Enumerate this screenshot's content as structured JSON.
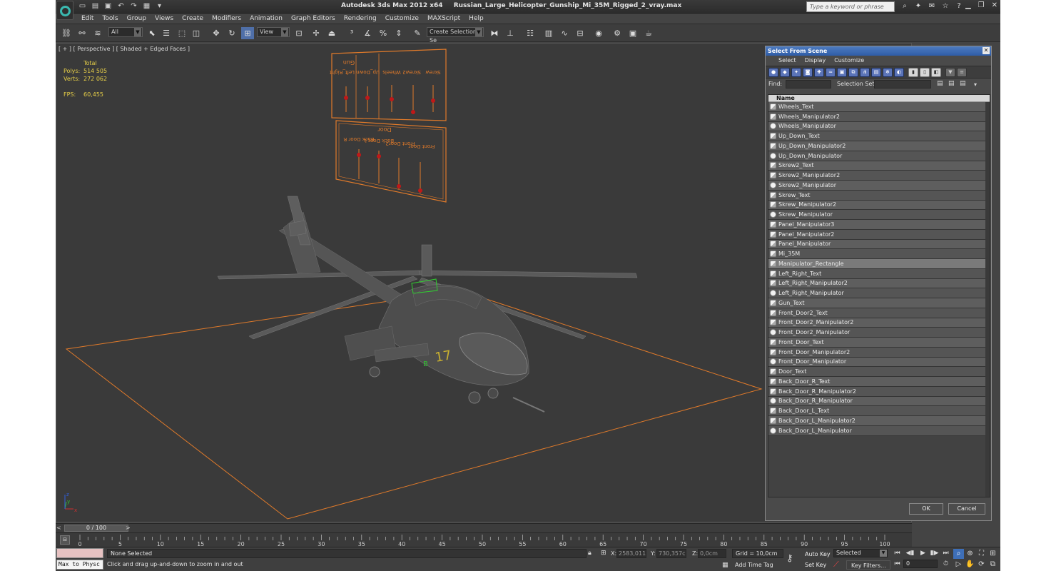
{
  "window": {
    "app_title": "Autodesk 3ds Max  2012 x64",
    "file_name": "Russian_Large_Helicopter_Gunship_Mi_35M_Rigged_2_vray.max",
    "search_placeholder": "Type a keyword or phrase"
  },
  "menu": [
    "Edit",
    "Tools",
    "Group",
    "Views",
    "Create",
    "Modifiers",
    "Animation",
    "Graph Editors",
    "Rendering",
    "Customize",
    "MAXScript",
    "Help"
  ],
  "toolbar": {
    "filter_value": "All",
    "refcoord_value": "View",
    "selection_set_placeholder": "Create Selection Se"
  },
  "viewport": {
    "label": "[ + ] [ Perspective ] [ Shaded + Edged Faces ]",
    "stats_header": "Total",
    "polys_label": "Polys:",
    "polys_value": "514 505",
    "verts_label": "Verts:",
    "verts_value": "272 062",
    "fps_label": "FPS:",
    "fps_value": "60,455",
    "panel1": {
      "sliders": [
        "Gun Up_Down Left_Right",
        "Wheels",
        "Skrew2",
        "Skrew"
      ],
      "labels": [
        "Gun",
        "Up_Down Left_Right",
        "Wheels",
        "Skrew2",
        "Skrew"
      ]
    },
    "panel2": {
      "labels": [
        "Door",
        "Back Door R",
        "Back Door L",
        "Front Door2",
        "Front Door"
      ]
    },
    "tail_number": "17",
    "tail_letter": "B",
    "axis_x": "x",
    "axis_y": "y",
    "axis_z": "z"
  },
  "dialog": {
    "title": "Select From Scene",
    "menu": [
      "Select",
      "Display",
      "Customize"
    ],
    "find_label": "Find:",
    "selection_set_label": "Selection Set:",
    "column_name": "Name",
    "items": [
      {
        "name": "Wheels_Text",
        "icon": "text-shape"
      },
      {
        "name": "Wheels_Manipulator2",
        "icon": "text-shape"
      },
      {
        "name": "Wheels_Manipulator",
        "icon": "sphere"
      },
      {
        "name": "Up_Down_Text",
        "icon": "text-shape"
      },
      {
        "name": "Up_Down_Manipulator2",
        "icon": "text-shape"
      },
      {
        "name": "Up_Down_Manipulator",
        "icon": "sphere"
      },
      {
        "name": "Skrew2_Text",
        "icon": "text-shape"
      },
      {
        "name": "Skrew2_Manipulator2",
        "icon": "text-shape"
      },
      {
        "name": "Skrew2_Manipulator",
        "icon": "sphere"
      },
      {
        "name": "Skrew_Text",
        "icon": "text-shape"
      },
      {
        "name": "Skrew_Manipulator2",
        "icon": "text-shape"
      },
      {
        "name": "Skrew_Manipulator",
        "icon": "sphere"
      },
      {
        "name": "Panel_Manipulator3",
        "icon": "text-shape"
      },
      {
        "name": "Panel_Manipulator2",
        "icon": "text-shape"
      },
      {
        "name": "Panel_Manipulator",
        "icon": "text-shape"
      },
      {
        "name": "Mi_35M",
        "icon": "text-shape"
      },
      {
        "name": "Manipulator_Rectangle",
        "icon": "text-shape",
        "selected": true
      },
      {
        "name": "Left_Right_Text",
        "icon": "text-shape"
      },
      {
        "name": "Left_Right_Manipulator2",
        "icon": "text-shape"
      },
      {
        "name": "Left_Right_Manipulator",
        "icon": "sphere"
      },
      {
        "name": "Gun_Text",
        "icon": "text-shape"
      },
      {
        "name": "Front_Door2_Text",
        "icon": "text-shape"
      },
      {
        "name": "Front_Door2_Manipulator2",
        "icon": "text-shape"
      },
      {
        "name": "Front_Door2_Manipulator",
        "icon": "sphere"
      },
      {
        "name": "Front_Door_Text",
        "icon": "text-shape"
      },
      {
        "name": "Front_Door_Manipulator2",
        "icon": "text-shape"
      },
      {
        "name": "Front_Door_Manipulator",
        "icon": "sphere"
      },
      {
        "name": "Door_Text",
        "icon": "text-shape"
      },
      {
        "name": "Back_Door_R_Text",
        "icon": "text-shape"
      },
      {
        "name": "Back_Door_R_Manipulator2",
        "icon": "text-shape"
      },
      {
        "name": "Back_Door_R_Manipulator",
        "icon": "sphere"
      },
      {
        "name": "Back_Door_L_Text",
        "icon": "text-shape"
      },
      {
        "name": "Back_Door_L_Manipulator2",
        "icon": "text-shape"
      },
      {
        "name": "Back_Door_L_Manipulator",
        "icon": "sphere"
      }
    ],
    "ok_label": "OK",
    "cancel_label": "Cancel"
  },
  "timeline": {
    "frame_display": "0 / 100",
    "tick_labels": [
      "0",
      "5",
      "10",
      "15",
      "20",
      "25",
      "30",
      "35",
      "40",
      "45",
      "50",
      "55",
      "60",
      "65",
      "70",
      "75",
      "80",
      "85",
      "90",
      "95",
      "100"
    ]
  },
  "status": {
    "maxscript_text": "Max to Physc",
    "selection_text": "None Selected",
    "prompt_text": "Click and drag up-and-down to zoom in and out",
    "x_label": "X:",
    "x_value": "2583,011cr",
    "y_label": "Y:",
    "y_value": "730,357cm",
    "z_label": "Z:",
    "z_value": "0,0cm",
    "grid_text": "Grid = 10,0cm",
    "add_time_tag": "Add Time Tag",
    "auto_key": "Auto Key",
    "set_key": "Set Key",
    "key_mode": "Selected",
    "key_filters": "Key Filters...",
    "current_frame": "0"
  },
  "colors": {
    "viewport_bg": "#3a3a3a",
    "stats_text": "#e8d048",
    "manipulator_orange": "#e07a2a",
    "selection_blue": "#2f5da8"
  }
}
